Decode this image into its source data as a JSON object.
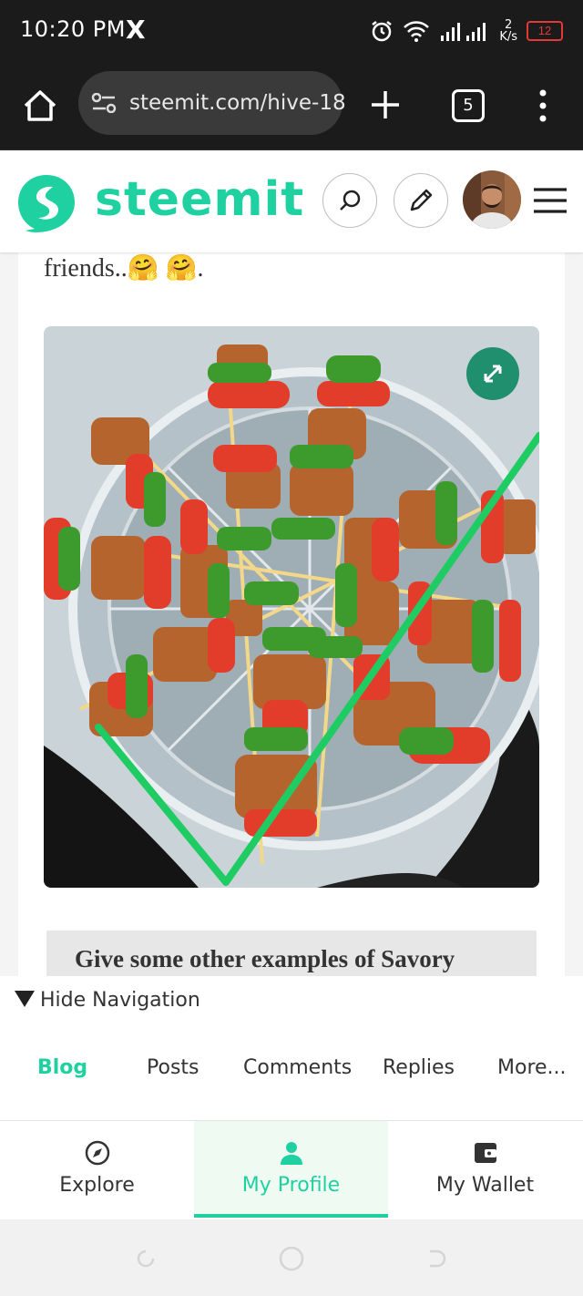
{
  "status_bar": {
    "time": "10:20 PM",
    "x_logo": "X",
    "net_speed_value": "2",
    "net_speed_unit": "K/s",
    "battery": "12",
    "battery_color": "#e53935"
  },
  "browser": {
    "url": "steemit.com/hive-18",
    "tab_count": "5"
  },
  "site": {
    "logo_text": "steemit",
    "brand_color": "#1fd1a1"
  },
  "content": {
    "paragraph": "friends..🤗 🤗.",
    "question": "Give some other examples of Savory"
  },
  "navigation": {
    "hide_label": "Hide Navigation",
    "profile_tabs": [
      "Blog",
      "Posts",
      "Comments",
      "Replies",
      "More..."
    ],
    "active_profile_tab": "Blog"
  },
  "bottom_tabs": {
    "explore": "Explore",
    "profile": "My Profile",
    "wallet": "My Wallet",
    "active": "My Profile"
  },
  "icons": [
    "x-logo-icon",
    "alarm-icon",
    "wifi-icon",
    "signal-icon",
    "battery-icon",
    "home-icon",
    "tune-icon",
    "plus-icon",
    "tabs-icon",
    "more-vert-icon",
    "search-icon",
    "pencil-icon",
    "hamburger-icon",
    "expand-icon",
    "compass-icon",
    "person-icon",
    "wallet-icon"
  ]
}
